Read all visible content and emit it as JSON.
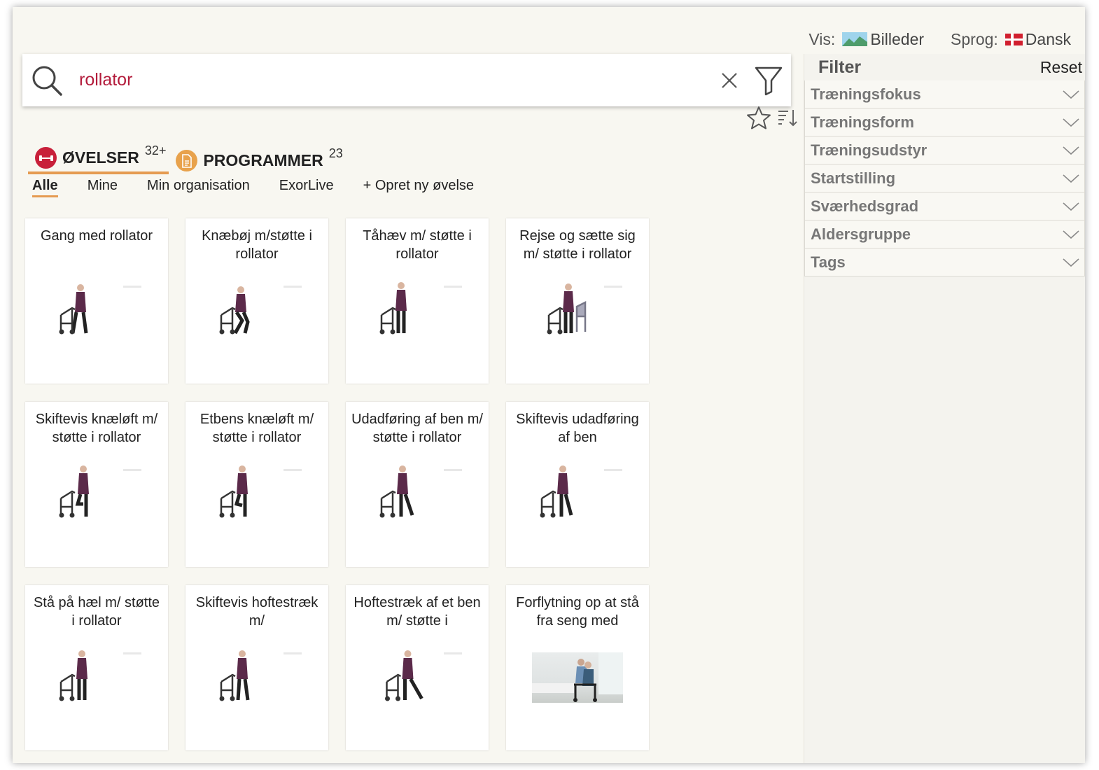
{
  "topbar": {
    "view_label": "Vis:",
    "view_value": "Billeder",
    "lang_label": "Sprog:",
    "lang_value": "Dansk"
  },
  "search": {
    "query": "rollator"
  },
  "tabs": [
    {
      "name": "ØVELSER",
      "count": "32+"
    },
    {
      "name": "PROGRAMMER",
      "count": "23"
    }
  ],
  "subtabs": [
    "Alle",
    "Mine",
    "Min organisation",
    "ExorLive",
    "+ Opret ny øvelse"
  ],
  "exercises": [
    "Gang med rollator",
    "Knæbøj m/støtte i rollator",
    "Tåhæv m/ støtte i rollator",
    "Rejse og sætte sig m/ støtte i rollator",
    "Skiftevis knæløft m/ støtte i rollator",
    "Etbens knæløft m/ støtte i rollator",
    "Udadføring af ben m/ støtte i rollator",
    "Skiftevis udadføring af ben",
    "Stå på hæl m/ støtte i rollator",
    "Skiftevis hoftestræk m/",
    "Hoftestræk af et ben m/ støtte i",
    "Forflytning op at stå fra seng med"
  ],
  "filter": {
    "title": "Filter",
    "reset": "Reset",
    "items": [
      "Træningsfokus",
      "Træningsform",
      "Træningsudstyr",
      "Startstilling",
      "Sværhedsgrad",
      "Aldersgruppe",
      "Tags"
    ]
  },
  "colors": {
    "accent": "#e59b51",
    "query": "#b31b3b",
    "exercise_badge": "#c8203a",
    "program_badge": "#e8a24c"
  }
}
